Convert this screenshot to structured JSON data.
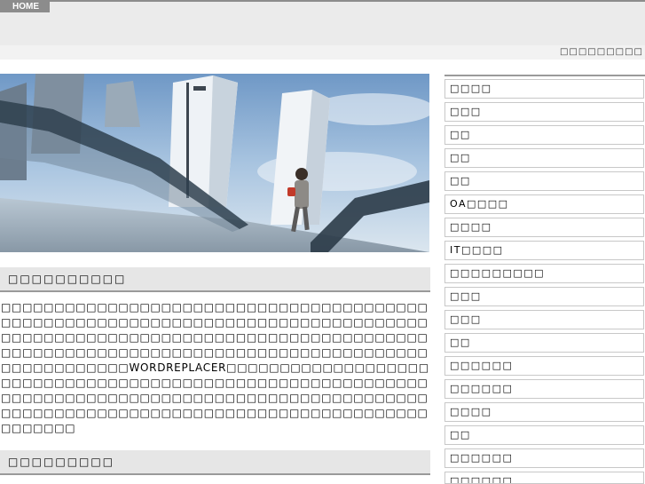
{
  "nav": {
    "home_label": "HOME"
  },
  "subbar": {
    "text": "□□□□□□□□□"
  },
  "hero": {
    "image": "city-bridge-photo"
  },
  "main": {
    "heading1": "□□□□□□□□□□",
    "paragraph": "□□□□□□□□□□□□□□□□□□□□□□□□□□□□□□□□□□□□□□□□□□□□□□□□□□□□□□□□□□□□□□□□□□□□□□□□□□□□□□□□□□□□□□□□□□□□□□□□□□□□□□□□□□□□□□□□□□□□□□□□□□□□□□□□□□□□□□□□□□□□□□□□□□□□□□□□□□□□□□□□□□□□□□□□□□□□WORDREPLACER□□□□□□□□□□□□□□□□□□□□□□□□□□□□□□□□□□□□□□□□□□□□□□□□□□□□□□□□□□□□□□□□□□□□□□□□□□□□□□□□□□□□□□□□□□□□□□□□□□□□□□□□□□□□□□□□□□□□□□□□□□□□□□□□□□□□□□□□□□□□□□□□□□",
    "heading2": "□□□□□□□□□"
  },
  "sidebar": {
    "items": [
      "□□□□",
      "□□□",
      "□□",
      "□□",
      "□□",
      "OA□□□□",
      "□□□□",
      "IT□□□□",
      "□□□□□□□□□",
      "□□□",
      "□□□",
      "□□",
      "□□□□□□",
      "□□□□□□",
      "□□□□",
      "□□",
      "□□□□□□",
      "□□□□□□"
    ]
  }
}
